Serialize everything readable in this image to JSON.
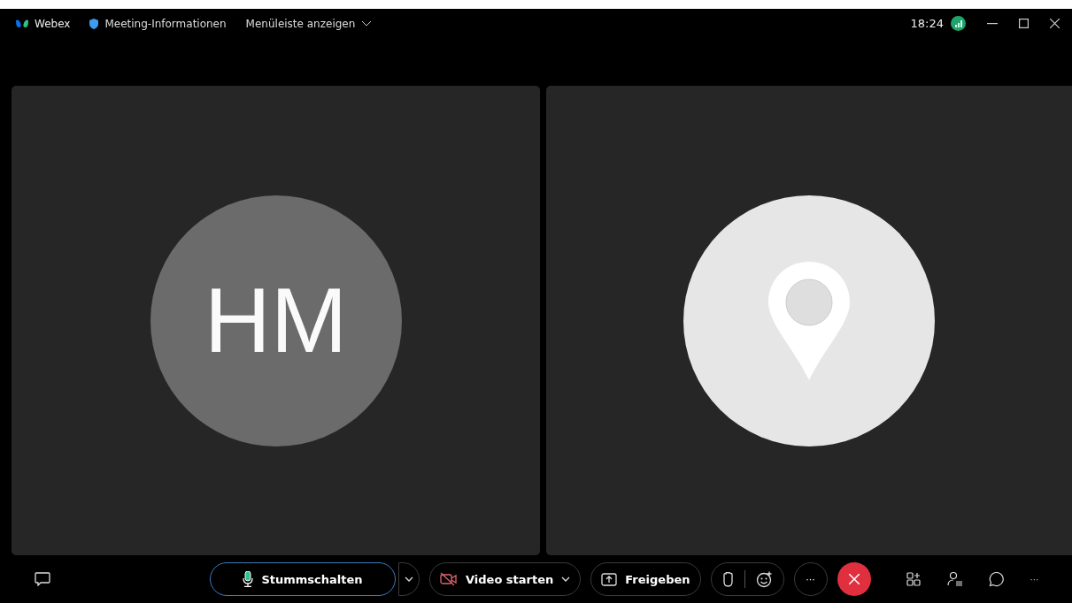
{
  "title_bar": {
    "app_name": "Webex",
    "meeting_info": "Meeting-Informationen",
    "menu_toggle": "Menüleiste anzeigen",
    "time": "18:24"
  },
  "tiles": [
    {
      "kind": "initials",
      "initials": "HM"
    },
    {
      "kind": "pin"
    }
  ],
  "toolbar": {
    "mute": {
      "label": "Stummschalten",
      "focused": true
    },
    "video": {
      "label": "Video starten"
    },
    "share": {
      "label": "Freigeben"
    },
    "more": "···",
    "overflow": "···"
  }
}
